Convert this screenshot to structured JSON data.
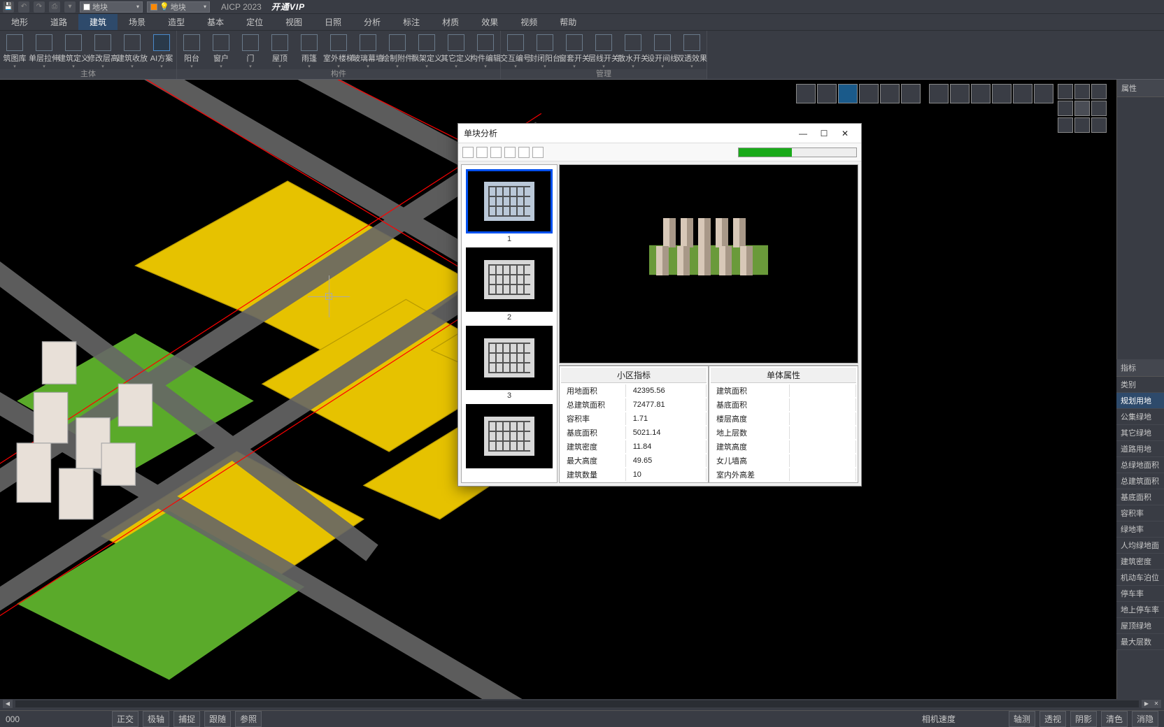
{
  "titlebar": {
    "combo1": "地块",
    "combo2": "地块",
    "version": "AICP 2023",
    "vip": "开通VIP"
  },
  "menu": [
    "地形",
    "道路",
    "建筑",
    "场景",
    "造型",
    "基本",
    "定位",
    "视图",
    "日照",
    "分析",
    "标注",
    "材质",
    "效果",
    "视频",
    "帮助"
  ],
  "active_menu": 2,
  "ribbon": [
    {
      "group": "主体",
      "tools": [
        "筑图库",
        "单层拉伸",
        "建筑定义",
        "修改层高",
        "建筑收放",
        "AI方案"
      ]
    },
    {
      "group": "构件",
      "tools": [
        "阳台",
        "窗户",
        "门",
        "屋顶",
        "雨篷",
        "室外楼梯",
        "玻璃幕墙",
        "绘制附件",
        "飘架定义",
        "其它定义",
        "构件编辑"
      ]
    },
    {
      "group": "管理",
      "tools": [
        "交互编号",
        "封闭阳台",
        "窗套开关",
        "层线开关",
        "散水开关",
        "设开间线",
        "双透效果"
      ]
    }
  ],
  "props_header": "属性",
  "metrics_header": "指标",
  "metrics": [
    "类别",
    "规划用地",
    "公集绿地",
    "其它绿地",
    "道路用地",
    "总绿地面积",
    "总建筑面积",
    "基底面积",
    "容积率",
    "绿地率",
    "人均绿地面",
    "建筑密度",
    "机动车泊位",
    "停车率",
    "地上停车率",
    "屋顶绿地",
    "最大层数"
  ],
  "metrics_sel": 1,
  "dialog": {
    "title": "单块分析",
    "thumbs": [
      "1",
      "2",
      "3"
    ],
    "table_left_header": "小区指标",
    "table_right_header": "单体属性",
    "left_rows": [
      [
        "用地面积",
        "42395.56"
      ],
      [
        "总建筑面积",
        "72477.81"
      ],
      [
        "容积率",
        "1.71"
      ],
      [
        "基底面积",
        "5021.14"
      ],
      [
        "建筑密度",
        "11.84"
      ],
      [
        "最大高度",
        "49.65"
      ],
      [
        "建筑数量",
        "10"
      ]
    ],
    "right_rows": [
      [
        "建筑面积",
        ""
      ],
      [
        "基底面积",
        ""
      ],
      [
        "楼层高度",
        ""
      ],
      [
        "地上层数",
        ""
      ],
      [
        "建筑高度",
        ""
      ],
      [
        "女儿墙高",
        ""
      ],
      [
        "室内外高差",
        ""
      ]
    ]
  },
  "status": {
    "coord": "000",
    "toggles": [
      "正交",
      "极轴",
      "捕捉",
      "跟随",
      "参照"
    ],
    "camera": "相机速度",
    "right": [
      "轴测",
      "透视",
      "阴影",
      "清色",
      "消隐"
    ]
  }
}
